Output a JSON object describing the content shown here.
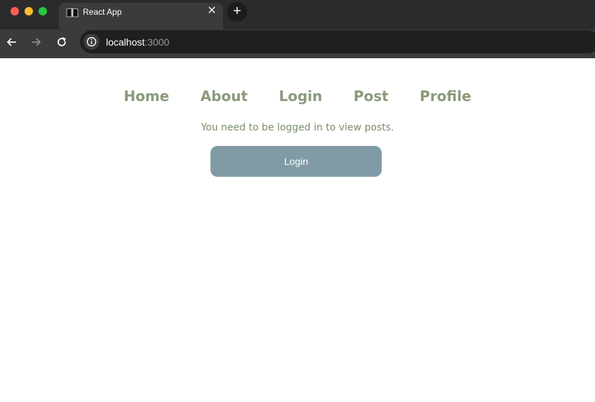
{
  "browser": {
    "tab": {
      "title": "React App",
      "favicon": "open-book-icon",
      "close_glyph": "✕"
    },
    "new_tab_glyph": "+",
    "address": {
      "host": "localhost",
      "port": ":3000"
    },
    "icons": {
      "back": "arrow-left-icon",
      "forward": "arrow-right-icon",
      "reload": "reload-icon",
      "site_info": "info-icon"
    },
    "colors": {
      "close": "#ff5f57",
      "minimize": "#febc2e",
      "maximize": "#28c840"
    }
  },
  "page": {
    "nav": [
      {
        "label": "Home"
      },
      {
        "label": "About"
      },
      {
        "label": "Login"
      },
      {
        "label": "Post"
      },
      {
        "label": "Profile"
      }
    ],
    "message": "You need to be logged in to view posts.",
    "login_button": "Login",
    "colors": {
      "nav_text": "#8a9a7a",
      "button_bg": "#819ba6",
      "button_text": "#ffffff"
    }
  }
}
